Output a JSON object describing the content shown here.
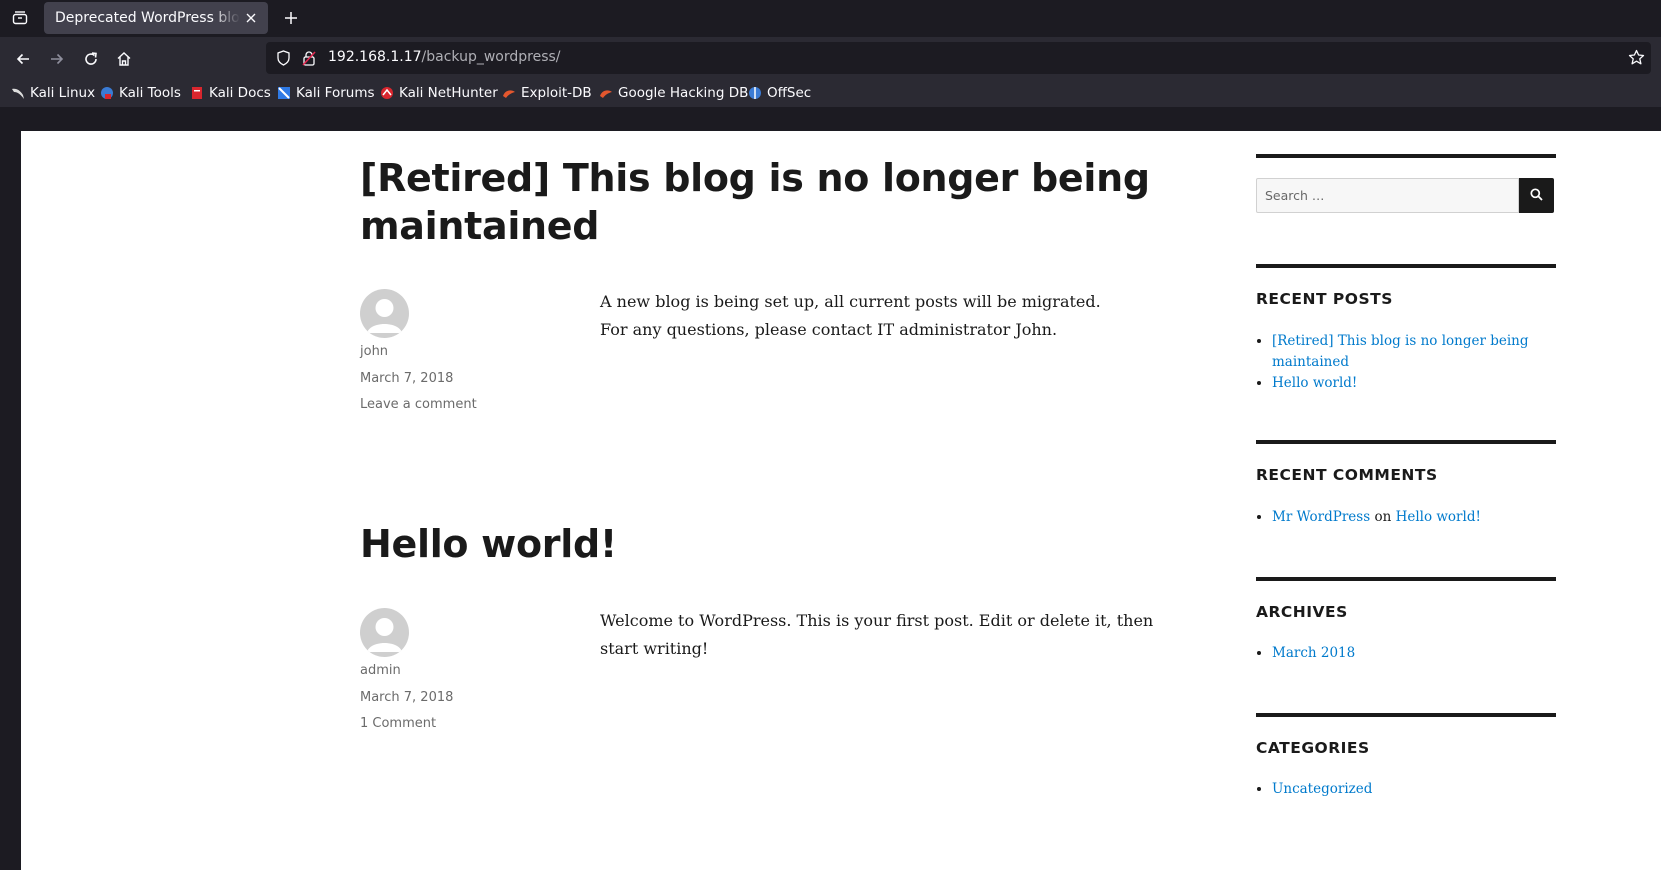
{
  "browser": {
    "tab_title": "Deprecated WordPress blog",
    "url_host": "192.168.1.17",
    "url_path": "/backup_wordpress/",
    "bookmarks": [
      {
        "label": "Kali Linux",
        "icon": "kali-dragon-icon",
        "color": "#ffffff"
      },
      {
        "label": "Kali Tools",
        "icon": "kali-tools-icon",
        "color": "#3a7bd5"
      },
      {
        "label": "Kali Docs",
        "icon": "kali-docs-icon",
        "color": "#d9262e"
      },
      {
        "label": "Kali Forums",
        "icon": "kali-forums-icon",
        "color": "#2f7ae5"
      },
      {
        "label": "Kali NetHunter",
        "icon": "kali-nethunter-icon",
        "color": "#d9262e"
      },
      {
        "label": "Exploit-DB",
        "icon": "exploit-db-icon",
        "color": "#e4572e"
      },
      {
        "label": "Google Hacking DB",
        "icon": "ghdb-icon",
        "color": "#e4572e"
      },
      {
        "label": "OffSec",
        "icon": "offsec-icon",
        "color": "#3a7bd5"
      }
    ]
  },
  "posts": [
    {
      "title": "[Retired] This blog is no longer being maintained",
      "author": "john",
      "date": "March 7, 2018",
      "comments_link": "Leave a comment",
      "body": [
        "A new blog is being set up, all current posts will be migrated.",
        "For any questions, please contact IT administrator John."
      ]
    },
    {
      "title": "Hello world!",
      "author": "admin",
      "date": "March 7, 2018",
      "comments_link": "1 Comment",
      "body": [
        "Welcome to WordPress. This is your first post. Edit or delete it, then start writing!"
      ]
    }
  ],
  "sidebar": {
    "search_placeholder": "Search …",
    "recent_posts": {
      "title": "RECENT POSTS",
      "items": [
        "[Retired] This blog is no longer being maintained",
        "Hello world!"
      ]
    },
    "recent_comments": {
      "title": "RECENT COMMENTS",
      "author": "Mr WordPress",
      "on": "on",
      "post": "Hello world!"
    },
    "archives": {
      "title": "ARCHIVES",
      "items": [
        "March 2018"
      ]
    },
    "categories": {
      "title": "CATEGORIES",
      "items": [
        "Uncategorized"
      ]
    }
  },
  "colors": {
    "link": "#007acc",
    "text": "#1a1a1a",
    "meta": "#6b6b6b"
  }
}
